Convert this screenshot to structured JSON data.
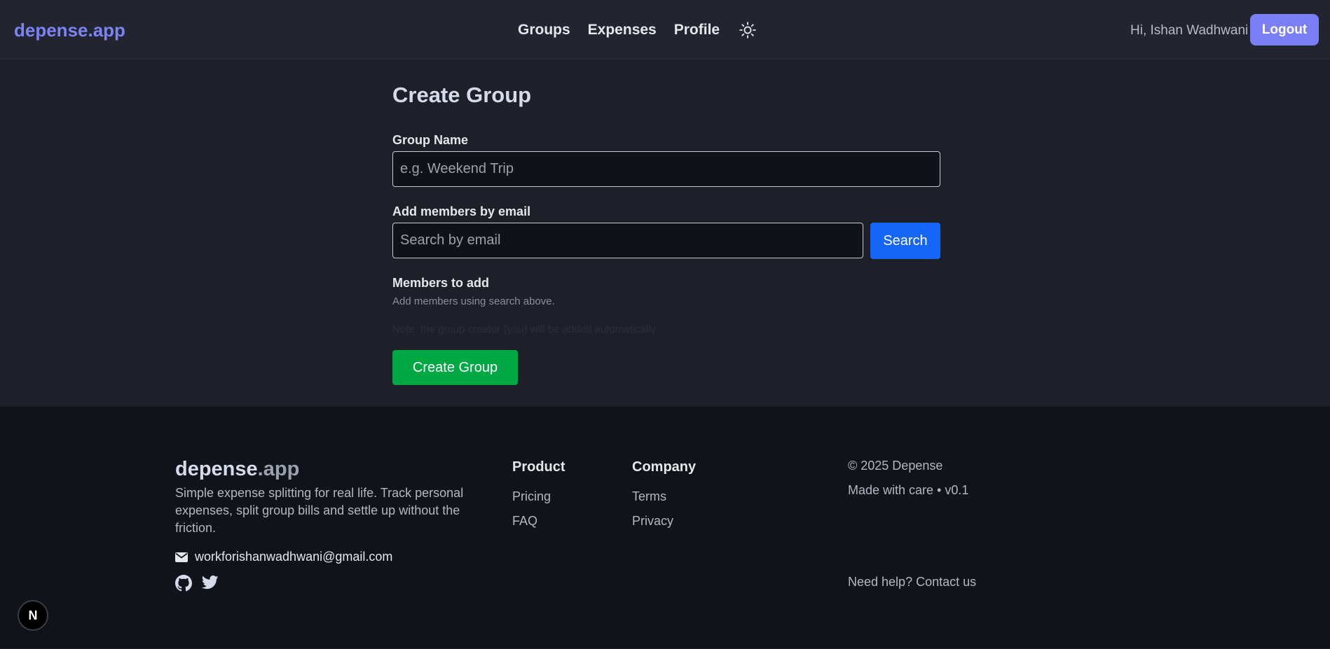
{
  "navbar": {
    "brand": "depense.app",
    "links": [
      {
        "label": "Groups"
      },
      {
        "label": "Expenses"
      },
      {
        "label": "Profile"
      }
    ],
    "theme_icon": "sun-icon",
    "greeting": "Hi, Ishan Wadhwani",
    "logout_label": "Logout"
  },
  "form": {
    "title": "Create Group",
    "group_name_label": "Group Name",
    "group_name_placeholder": "e.g. Weekend Trip",
    "group_name_value": "",
    "members_label": "Add members by email",
    "search_placeholder": "Search by email",
    "search_value": "",
    "search_button": "Search",
    "members_to_add_label": "Members to add",
    "members_hint": "Add members using search above.",
    "note": "Note: the group creator (you) will be added automatically.",
    "create_button": "Create Group"
  },
  "footer": {
    "brand_primary": "depense",
    "brand_secondary": ".app",
    "tagline": "Simple expense splitting for real life. Track personal expenses, split group bills and settle up without the friction.",
    "email": "workforishanwadhwani@gmail.com",
    "email_icon": "envelope-icon",
    "social_icons": [
      "github-icon",
      "twitter-icon"
    ],
    "product": {
      "heading": "Product",
      "links": [
        {
          "label": "Pricing"
        },
        {
          "label": "FAQ"
        }
      ]
    },
    "company": {
      "heading": "Company",
      "links": [
        {
          "label": "Terms"
        },
        {
          "label": "Privacy"
        }
      ]
    },
    "copyright": "© 2025 Depense",
    "made_with": "Made with care • v0.1",
    "help_link": "Need help? Contact us"
  },
  "dev_badge": "N",
  "colors": {
    "brand": "#7c83f2",
    "logout": "#7b7ff5",
    "search": "#1565f6",
    "create": "#00a844",
    "background": "#1d1f29",
    "footer": "#11131a"
  }
}
